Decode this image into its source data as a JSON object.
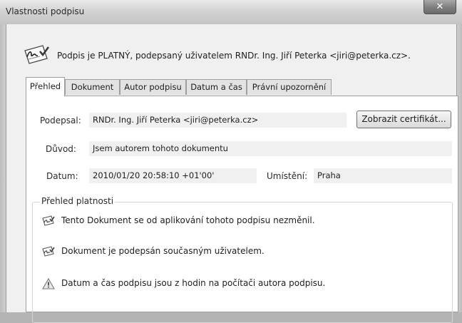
{
  "window": {
    "title": "Vlastnosti podpisu",
    "close_glyph": "✕"
  },
  "status": {
    "icon": "signature-valid-icon",
    "text": "Podpis je PLATNÝ, podepsaný uživatelem RNDr. Ing. Jiří Peterka <jiri@peterka.cz>."
  },
  "tabs": [
    {
      "label": "Přehled",
      "active": true
    },
    {
      "label": "Dokument",
      "active": false
    },
    {
      "label": "Autor podpisu",
      "active": false
    },
    {
      "label": "Datum a čas",
      "active": false
    },
    {
      "label": "Právní upozornění",
      "active": false
    }
  ],
  "summary": {
    "signer_label": "Podepsal:",
    "signer_value": "RNDr. Ing. Jiří Peterka <jiri@peterka.cz>",
    "cert_button": "Zobrazit certifikát...",
    "reason_label": "Důvod:",
    "reason_value": "Jsem autorem tohoto dokumentu",
    "date_label": "Datum:",
    "date_value": "2010/01/20 20:58:10 +01'00'",
    "location_label": "Umístění:",
    "location_value": "Praha"
  },
  "validity": {
    "title": "Přehled platnosti",
    "items": [
      {
        "icon": "document-unchanged-icon",
        "text": "Tento Dokument se od aplikování tohoto podpisu nezměnil."
      },
      {
        "icon": "signer-valid-icon",
        "text": "Dokument je podepsán současným uživatelem."
      },
      {
        "icon": "warning-icon",
        "text": "Datum a čas podpisu jsou z hodin na počítači autora podpisu."
      }
    ]
  }
}
